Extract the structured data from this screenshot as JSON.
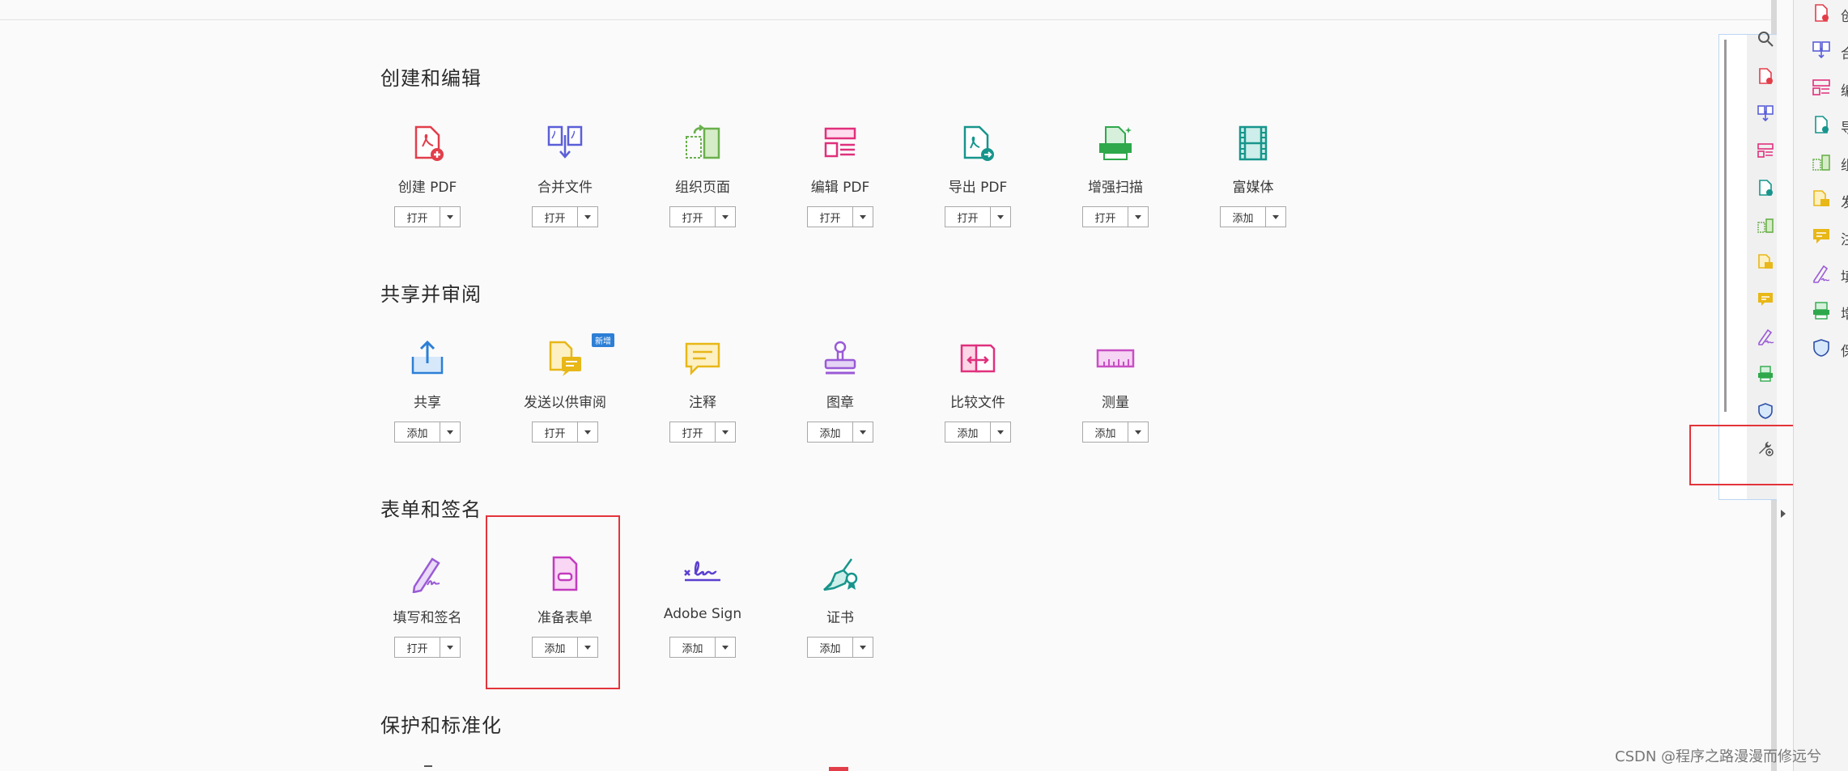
{
  "sections": {
    "create_edit": "创建和编辑",
    "share_review": "共享并审阅",
    "forms_sign": "表单和签名",
    "protect": "保护和标准化"
  },
  "tools": {
    "create_pdf": {
      "label": "创建 PDF",
      "button": "打开",
      "icon": "create-pdf-icon",
      "color": "#e23e4a"
    },
    "combine": {
      "label": "合并文件",
      "button": "打开",
      "icon": "combine-files-icon",
      "color": "#5b5fd7"
    },
    "organize": {
      "label": "组织页面",
      "button": "打开",
      "icon": "organize-pages-icon",
      "color": "#6ab04c"
    },
    "edit_pdf": {
      "label": "编辑 PDF",
      "button": "打开",
      "icon": "edit-pdf-icon",
      "color": "#e0307c"
    },
    "export_pdf": {
      "label": "导出 PDF",
      "button": "打开",
      "icon": "export-pdf-icon",
      "color": "#17958c"
    },
    "enhance_scan": {
      "label": "增强扫描",
      "button": "打开",
      "icon": "enhance-scan-icon",
      "color": "#2ea84b"
    },
    "rich_media": {
      "label": "富媒体",
      "button": "添加",
      "icon": "rich-media-icon",
      "color": "#17958c"
    },
    "share": {
      "label": "共享",
      "button": "添加",
      "icon": "share-icon",
      "color": "#2d7fd6"
    },
    "send_review": {
      "label": "发送以供审阅",
      "button": "打开",
      "icon": "send-for-review-icon",
      "color": "#e8b718",
      "badge": "新增"
    },
    "comment": {
      "label": "注释",
      "button": "打开",
      "icon": "comment-icon",
      "color": "#e8b718"
    },
    "stamp": {
      "label": "图章",
      "button": "添加",
      "icon": "stamp-icon",
      "color": "#9a5ad6"
    },
    "compare": {
      "label": "比较文件",
      "button": "添加",
      "icon": "compare-files-icon",
      "color": "#e0307c"
    },
    "measure": {
      "label": "测量",
      "button": "添加",
      "icon": "measure-icon",
      "color": "#c84fc4"
    },
    "fill_sign": {
      "label": "填写和签名",
      "button": "打开",
      "icon": "fill-sign-icon",
      "color": "#9a5ad6"
    },
    "prepare_form": {
      "label": "准备表单",
      "button": "添加",
      "icon": "prepare-form-icon",
      "color": "#c23bbd"
    },
    "adobe_sign": {
      "label": "Adobe Sign",
      "button": "添加",
      "icon": "adobe-sign-icon",
      "color": "#5b3fd0"
    },
    "certificate": {
      "label": "证书",
      "button": "添加",
      "icon": "certificate-icon",
      "color": "#17958c"
    }
  },
  "highlight_color": "#e3343b",
  "right_strip_fragments": [
    "创",
    "合",
    "编",
    "导",
    "组",
    "发",
    "注",
    "填",
    "增",
    "保"
  ],
  "watermark": "CSDN @程序之路漫漫而修远兮"
}
